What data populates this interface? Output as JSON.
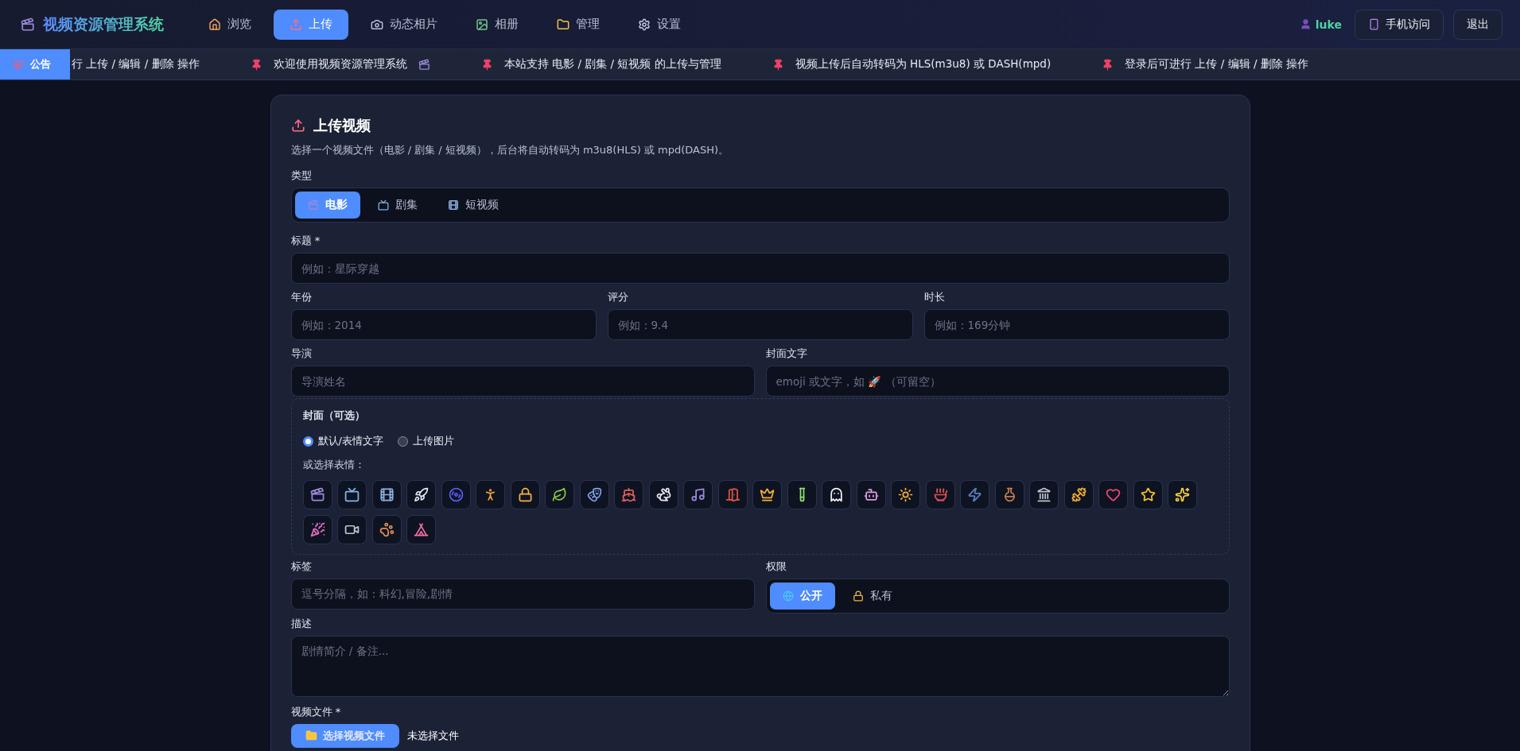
{
  "header": {
    "brand": "视频资源管理系统",
    "nav": [
      {
        "label": "浏览",
        "kind": "house",
        "selected": false
      },
      {
        "label": "上传",
        "kind": "upload",
        "selected": true
      },
      {
        "label": "动态相片",
        "kind": "camera",
        "selected": false
      },
      {
        "label": "相册",
        "kind": "image",
        "selected": false
      },
      {
        "label": "管理",
        "kind": "folder",
        "selected": false
      },
      {
        "label": "设置",
        "kind": "settings",
        "selected": false
      }
    ],
    "user": "luke",
    "mobile_button": "手机访问",
    "logout_button": "退出"
  },
  "ticker": {
    "badge": "公告",
    "items": [
      {
        "text": "行 上传 / 编辑 / 删除 操作",
        "kind": "plain"
      },
      {
        "text": "欢迎使用视频资源管理系统",
        "kind": "pinclapper"
      },
      {
        "text": "本站支持 电影 / 剧集 / 短视频 的上传与管理",
        "kind": "pin"
      },
      {
        "text": "视频上传后自动转码为 HLS(m3u8) 或 DASH(mpd)",
        "kind": "pin"
      },
      {
        "text": "登录后可进行 上传 / 编辑 / 删除 操作",
        "kind": "pin"
      }
    ]
  },
  "form": {
    "title": "上传视频",
    "subtitle": "选择一个视频文件（电影 / 剧集 / 短视频），后台将自动转码为 m3u8(HLS) 或 mpd(DASH)。",
    "type_label": "类型",
    "types": [
      {
        "label": "电影",
        "kind": "clapper",
        "selected": true
      },
      {
        "label": "剧集",
        "kind": "tv",
        "selected": false
      },
      {
        "label": "短视频",
        "kind": "film",
        "selected": false
      }
    ],
    "title_field": {
      "label": "标题 *",
      "placeholder": "例如：星际穿越"
    },
    "row_fields": [
      {
        "label": "年份",
        "placeholder": "例如：2014"
      },
      {
        "label": "评分",
        "placeholder": "例如：9.4"
      },
      {
        "label": "时长",
        "placeholder": "例如：169分钟"
      }
    ],
    "director_field": {
      "label": "导演",
      "placeholder": "导演姓名"
    },
    "cover_text_field": {
      "label": "封面文字",
      "placeholder": "emoji 或文字，如 🚀 （可留空）"
    },
    "cover": {
      "title": "封面（可选）",
      "options": [
        {
          "label": "默认/表情文字",
          "selected": true
        },
        {
          "label": "上传图片",
          "selected": false
        }
      ],
      "emoji_label": "或选择表情：",
      "emojis": [
        {
          "kind": "clapper"
        },
        {
          "kind": "tv"
        },
        {
          "kind": "film"
        },
        {
          "kind": "rocket"
        },
        {
          "kind": "spiral"
        },
        {
          "kind": "runner"
        },
        {
          "kind": "lock"
        },
        {
          "kind": "leaf"
        },
        {
          "kind": "masks"
        },
        {
          "kind": "ship"
        },
        {
          "kind": "rabbit"
        },
        {
          "kind": "music"
        },
        {
          "kind": "gate"
        },
        {
          "kind": "crown"
        },
        {
          "kind": "tube"
        },
        {
          "kind": "ghost"
        },
        {
          "kind": "robot"
        },
        {
          "kind": "sun"
        },
        {
          "kind": "bowl"
        },
        {
          "kind": "bolt"
        },
        {
          "kind": "flask"
        },
        {
          "kind": "landmark"
        },
        {
          "kind": "dumbbell"
        },
        {
          "kind": "heart"
        },
        {
          "kind": "star"
        },
        {
          "kind": "sparkles"
        },
        {
          "kind": "party"
        },
        {
          "kind": "video"
        },
        {
          "kind": "paw"
        },
        {
          "kind": "tent"
        }
      ]
    },
    "tags_field": {
      "label": "标签",
      "placeholder": "逗号分隔，如：科幻,冒险,剧情"
    },
    "permission": {
      "label": "权限",
      "options": [
        {
          "label": "公开",
          "kind": "globe",
          "selected": true
        },
        {
          "label": "私有",
          "kind": "lock",
          "selected": false
        }
      ]
    },
    "description_field": {
      "label": "描述",
      "placeholder": "剧情简介 / 备注..."
    },
    "file": {
      "label": "视频文件 *",
      "button": "选择视频文件",
      "status": "未选择文件"
    }
  }
}
